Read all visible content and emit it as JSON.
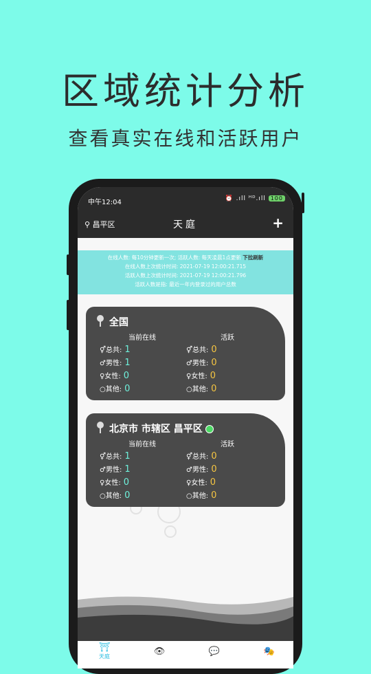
{
  "headline": "区域统计分析",
  "subheadline": "查看真实在线和活跃用户",
  "status": {
    "time": "中午12:04",
    "icons": "⏰ .ıll ᴴᴰ.ıll ",
    "battery": "100"
  },
  "appbar": {
    "location": "昌平区",
    "title": "天庭",
    "add": "+"
  },
  "info": {
    "line1": "在线人数: 每10分钟更新一次;  活跃人数: 每天凌晨1点更新",
    "pull": "下拉刷新",
    "line2": "在线人数上次统计时间: 2021-07-19 12:00:21.715",
    "line3": "活跃人数上次统计时间: 2021-07-19 12:00:21.796",
    "line4": "活跃人数是指: 最近一年内登录过的用户总数"
  },
  "cards": [
    {
      "name": "全国",
      "online_header": "当前在线",
      "active_header": "活跃",
      "online": [
        {
          "label": "总共:",
          "value": "1"
        },
        {
          "label": "男性:",
          "value": "1"
        },
        {
          "label": "女性:",
          "value": "0"
        },
        {
          "label": "其他:",
          "value": "0"
        }
      ],
      "active": [
        {
          "label": "总共:",
          "value": "0"
        },
        {
          "label": "男性:",
          "value": "0"
        },
        {
          "label": "女性:",
          "value": "0"
        },
        {
          "label": "其他:",
          "value": "0"
        }
      ]
    },
    {
      "name": "北京市 市辖区 昌平区",
      "online_header": "当前在线",
      "active_header": "活跃",
      "online": [
        {
          "label": "总共:",
          "value": "1"
        },
        {
          "label": "男性:",
          "value": "1"
        },
        {
          "label": "女性:",
          "value": "0"
        },
        {
          "label": "其他:",
          "value": "0"
        }
      ],
      "active": [
        {
          "label": "总共:",
          "value": "0"
        },
        {
          "label": "男性:",
          "value": "0"
        },
        {
          "label": "女性:",
          "value": "0"
        },
        {
          "label": "其他:",
          "value": "0"
        }
      ]
    }
  ],
  "tabbar": {
    "home_label": "天庭"
  },
  "colors": {
    "background": "#7dfbe9",
    "accent": "#29bde0",
    "online": "#6ff1dc",
    "active": "#f5c542"
  }
}
